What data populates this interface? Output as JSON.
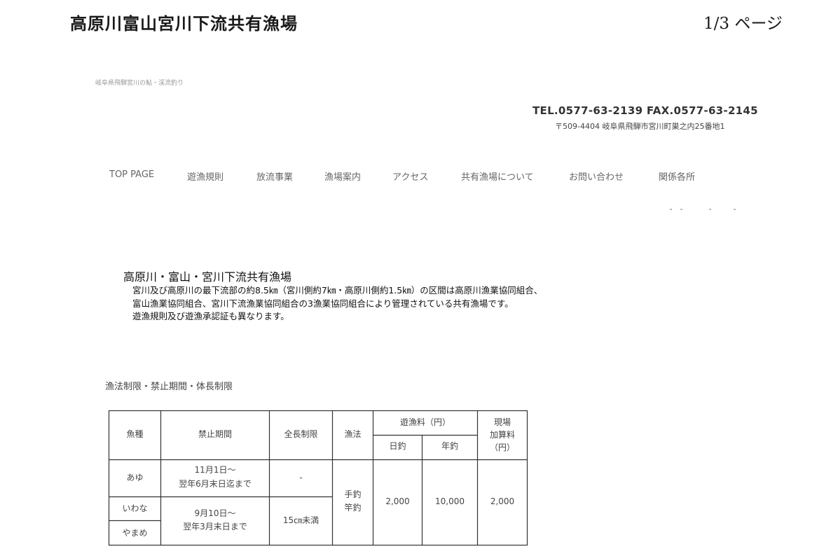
{
  "header": {
    "title": "高原川富山宮川下流共有漁場",
    "page_indicator": {
      "current_total": "1/3",
      "suffix": " ページ"
    }
  },
  "site": {
    "tagline": "岐阜県飛騨宮川の鮎・渓流釣り",
    "tel_fax": "TEL.0577-63-2139 FAX.0577-63-2145",
    "address": "〒509-4404 岐阜県飛騨市宮川町巣之内25番地1"
  },
  "nav": {
    "items": [
      "TOP PAGE",
      "遊漁規則",
      "放流事業",
      "漁場案内",
      "アクセス",
      "共有漁場について",
      "お問い合わせ",
      "関係各所"
    ]
  },
  "intro": {
    "heading": "高原川・富山・宮川下流共有漁場",
    "lines": [
      "宮川及び高原川の最下流部の約8.5㎞（宮川側約7㎞・高原川側約1.5㎞）の区間は高原川漁業協同組合、",
      "富山漁業協同組合、宮川下流漁業協同組合の3漁業協同組合により管理されている共有漁場です。",
      "遊漁規則及び遊漁承認証も異なります。"
    ]
  },
  "rules_section": {
    "heading": "漁法制限・禁止期間・体長制限",
    "table": {
      "headers": {
        "species": "魚種",
        "closed_period": "禁止期間",
        "length_limit": "全長制限",
        "method": "漁法",
        "fee": "遊漁料（円）",
        "day": "日釣",
        "year": "年釣",
        "onsite_line1": "現場",
        "onsite_line2": "加算料",
        "onsite_line3": "（円）"
      },
      "species": [
        "あゆ",
        "いわな",
        "やまめ"
      ],
      "ayu_period": [
        "11月1日～",
        "翌年6月末日迄まで"
      ],
      "ayu_length": "-",
      "trout_period": [
        "9月10日～",
        "翌年3月末日まで"
      ],
      "trout_length": "15㎝未満",
      "method": [
        "手釣",
        "竿釣"
      ],
      "fee_day": "2,000",
      "fee_year": "10,000",
      "fee_onsite": "2,000"
    }
  }
}
